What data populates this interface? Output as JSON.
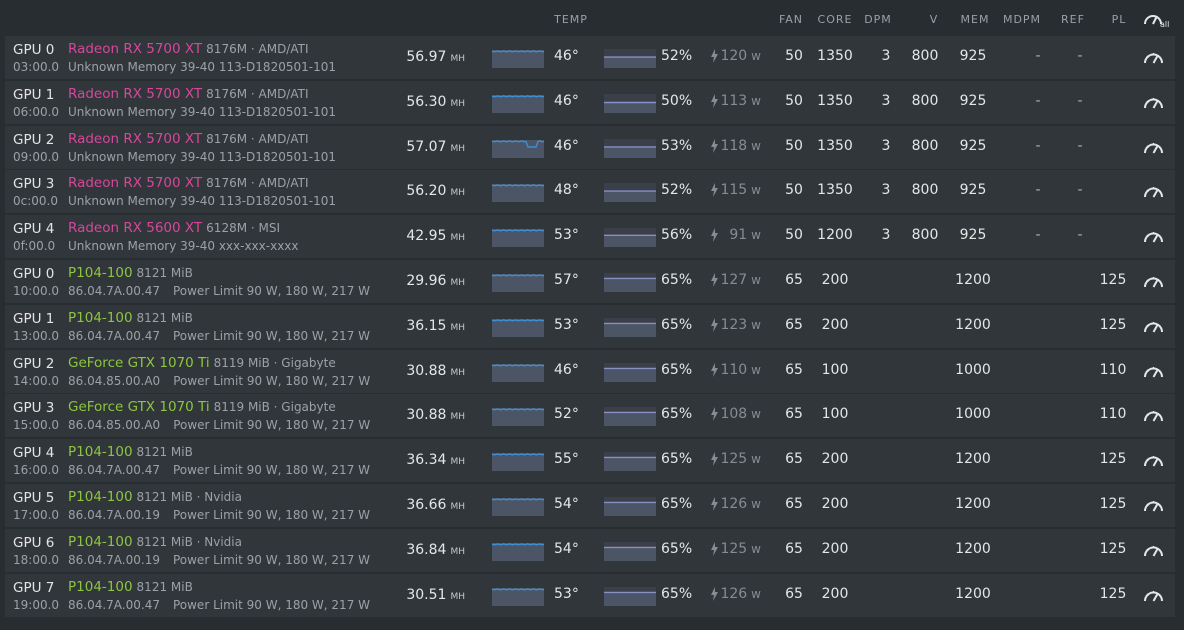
{
  "header": {
    "temp": "TEMP",
    "fan": "FAN",
    "core": "CORE",
    "dpm": "DPM",
    "v": "V",
    "mem": "MEM",
    "mdpm": "MDPM",
    "ref": "REF",
    "pl": "PL",
    "all": "all"
  },
  "units": {
    "hashrate": "MH",
    "power": "w"
  },
  "colors": {
    "amd": "#d6479b",
    "nvidia": "#8cc63f",
    "spark": "#3d8fd4",
    "fan": "#8a8fc4",
    "background": "#282d32",
    "row": "#31363b"
  },
  "icons": {
    "power": "lightning-bolt-icon",
    "tuning": "speedometer-icon"
  },
  "gpus": [
    {
      "vendor": "amd",
      "name": "GPU 0",
      "bus": "03:00.0",
      "model": "Radeon RX 5700 XT",
      "mem_info": "8176M · AMD/ATI",
      "line2": "Unknown Memory 39-40 113-D1820501-101",
      "power_limit": "",
      "hashrate": "56.97",
      "temp": "46°",
      "fan_pct": "52%",
      "fan_level": 0.52,
      "power": "120",
      "fan": "50",
      "core": "1350",
      "dpm": "3",
      "v": "800",
      "mem": "925",
      "mdpm": "-",
      "ref": "-",
      "pl": "",
      "dip": false
    },
    {
      "vendor": "amd",
      "name": "GPU 1",
      "bus": "06:00.0",
      "model": "Radeon RX 5700 XT",
      "mem_info": "8176M · AMD/ATI",
      "line2": "Unknown Memory 39-40 113-D1820501-101",
      "power_limit": "",
      "hashrate": "56.30",
      "temp": "46°",
      "fan_pct": "50%",
      "fan_level": 0.5,
      "power": "113",
      "fan": "50",
      "core": "1350",
      "dpm": "3",
      "v": "800",
      "mem": "925",
      "mdpm": "-",
      "ref": "-",
      "pl": "",
      "dip": false
    },
    {
      "vendor": "amd",
      "name": "GPU 2",
      "bus": "09:00.0",
      "model": "Radeon RX 5700 XT",
      "mem_info": "8176M · AMD/ATI",
      "line2": "Unknown Memory 39-40 113-D1820501-101",
      "power_limit": "",
      "hashrate": "57.07",
      "temp": "46°",
      "fan_pct": "53%",
      "fan_level": 0.53,
      "power": "118",
      "fan": "50",
      "core": "1350",
      "dpm": "3",
      "v": "800",
      "mem": "925",
      "mdpm": "-",
      "ref": "-",
      "pl": "",
      "dip": true
    },
    {
      "vendor": "amd",
      "name": "GPU 3",
      "bus": "0c:00.0",
      "model": "Radeon RX 5700 XT",
      "mem_info": "8176M · AMD/ATI",
      "line2": "Unknown Memory 39-40 113-D1820501-101",
      "power_limit": "",
      "hashrate": "56.20",
      "temp": "48°",
      "fan_pct": "52%",
      "fan_level": 0.52,
      "power": "115",
      "fan": "50",
      "core": "1350",
      "dpm": "3",
      "v": "800",
      "mem": "925",
      "mdpm": "-",
      "ref": "-",
      "pl": "",
      "dip": false
    },
    {
      "vendor": "amd",
      "name": "GPU 4",
      "bus": "0f:00.0",
      "model": "Radeon RX 5600 XT",
      "mem_info": "6128M · MSI",
      "line2": "Unknown Memory 39-40 xxx-xxx-xxxx",
      "power_limit": "",
      "hashrate": "42.95",
      "temp": "53°",
      "fan_pct": "56%",
      "fan_level": 0.56,
      "power": "91",
      "fan": "50",
      "core": "1200",
      "dpm": "3",
      "v": "800",
      "mem": "925",
      "mdpm": "-",
      "ref": "-",
      "pl": "",
      "dip": false
    },
    {
      "vendor": "nvidia",
      "name": "GPU 0",
      "bus": "10:00.0",
      "model": "P104-100",
      "mem_info": "8121 MiB",
      "line2": "86.04.7A.00.47",
      "power_limit": "Power Limit 90 W, 180 W, 217 W",
      "hashrate": "29.96",
      "temp": "57°",
      "fan_pct": "65%",
      "fan_level": 0.65,
      "power": "127",
      "fan": "65",
      "core": "200",
      "dpm": "",
      "v": "",
      "mem": "1200",
      "mdpm": "",
      "ref": "",
      "pl": "125",
      "dip": false
    },
    {
      "vendor": "nvidia",
      "name": "GPU 1",
      "bus": "13:00.0",
      "model": "P104-100",
      "mem_info": "8121 MiB",
      "line2": "86.04.7A.00.47",
      "power_limit": "Power Limit 90 W, 180 W, 217 W",
      "hashrate": "36.15",
      "temp": "53°",
      "fan_pct": "65%",
      "fan_level": 0.65,
      "power": "123",
      "fan": "65",
      "core": "200",
      "dpm": "",
      "v": "",
      "mem": "1200",
      "mdpm": "",
      "ref": "",
      "pl": "125",
      "dip": false
    },
    {
      "vendor": "nvidia",
      "name": "GPU 2",
      "bus": "14:00.0",
      "model": "GeForce GTX 1070 Ti",
      "mem_info": "8119 MiB · Gigabyte",
      "line2": "86.04.85.00.A0",
      "power_limit": "Power Limit 90 W, 180 W, 217 W",
      "hashrate": "30.88",
      "temp": "46°",
      "fan_pct": "65%",
      "fan_level": 0.65,
      "power": "110",
      "fan": "65",
      "core": "100",
      "dpm": "",
      "v": "",
      "mem": "1000",
      "mdpm": "",
      "ref": "",
      "pl": "110",
      "dip": false
    },
    {
      "vendor": "nvidia",
      "name": "GPU 3",
      "bus": "15:00.0",
      "model": "GeForce GTX 1070 Ti",
      "mem_info": "8119 MiB · Gigabyte",
      "line2": "86.04.85.00.A0",
      "power_limit": "Power Limit 90 W, 180 W, 217 W",
      "hashrate": "30.88",
      "temp": "52°",
      "fan_pct": "65%",
      "fan_level": 0.65,
      "power": "108",
      "fan": "65",
      "core": "100",
      "dpm": "",
      "v": "",
      "mem": "1000",
      "mdpm": "",
      "ref": "",
      "pl": "110",
      "dip": false
    },
    {
      "vendor": "nvidia",
      "name": "GPU 4",
      "bus": "16:00.0",
      "model": "P104-100",
      "mem_info": "8121 MiB",
      "line2": "86.04.7A.00.47",
      "power_limit": "Power Limit 90 W, 180 W, 217 W",
      "hashrate": "36.34",
      "temp": "55°",
      "fan_pct": "65%",
      "fan_level": 0.65,
      "power": "125",
      "fan": "65",
      "core": "200",
      "dpm": "",
      "v": "",
      "mem": "1200",
      "mdpm": "",
      "ref": "",
      "pl": "125",
      "dip": false
    },
    {
      "vendor": "nvidia",
      "name": "GPU 5",
      "bus": "17:00.0",
      "model": "P104-100",
      "mem_info": "8121 MiB · Nvidia",
      "line2": "86.04.7A.00.19",
      "power_limit": "Power Limit 90 W, 180 W, 217 W",
      "hashrate": "36.66",
      "temp": "54°",
      "fan_pct": "65%",
      "fan_level": 0.65,
      "power": "126",
      "fan": "65",
      "core": "200",
      "dpm": "",
      "v": "",
      "mem": "1200",
      "mdpm": "",
      "ref": "",
      "pl": "125",
      "dip": false
    },
    {
      "vendor": "nvidia",
      "name": "GPU 6",
      "bus": "18:00.0",
      "model": "P104-100",
      "mem_info": "8121 MiB · Nvidia",
      "line2": "86.04.7A.00.19",
      "power_limit": "Power Limit 90 W, 180 W, 217 W",
      "hashrate": "36.84",
      "temp": "54°",
      "fan_pct": "65%",
      "fan_level": 0.65,
      "power": "125",
      "fan": "65",
      "core": "200",
      "dpm": "",
      "v": "",
      "mem": "1200",
      "mdpm": "",
      "ref": "",
      "pl": "125",
      "dip": false
    },
    {
      "vendor": "nvidia",
      "name": "GPU 7",
      "bus": "19:00.0",
      "model": "P104-100",
      "mem_info": "8121 MiB",
      "line2": "86.04.7A.00.47",
      "power_limit": "Power Limit 90 W, 180 W, 217 W",
      "hashrate": "30.51",
      "temp": "53°",
      "fan_pct": "65%",
      "fan_level": 0.65,
      "power": "126",
      "fan": "65",
      "core": "200",
      "dpm": "",
      "v": "",
      "mem": "1200",
      "mdpm": "",
      "ref": "",
      "pl": "125",
      "dip": false
    }
  ]
}
